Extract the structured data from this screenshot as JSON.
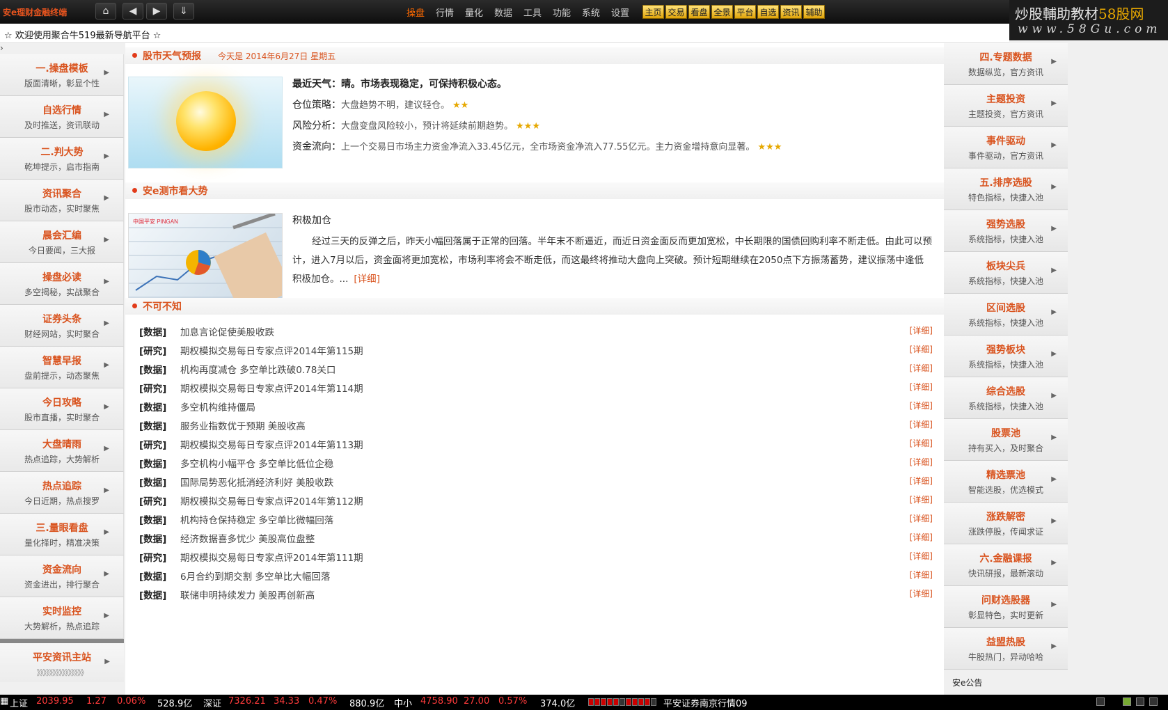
{
  "topbar": {
    "logo": "安e理财金融终端",
    "menu": [
      "操盘",
      "行情",
      "量化",
      "数据",
      "工具",
      "功能",
      "系统",
      "设置"
    ],
    "active_menu": "操盘",
    "quick": [
      "主页",
      "交易",
      "看盘",
      "全景",
      "平台",
      "自选",
      "资讯",
      "辅助"
    ],
    "brand_line1_a": "炒股輔助教材",
    "brand_line1_b": "58股网",
    "brand_line2": "www.58Gu.com"
  },
  "welcome": "☆ 欢迎使用聚合牛519最新导航平台 ☆",
  "left_nav": [
    {
      "title": "一.操盘模板",
      "sub": "版面清晰，彰显个性"
    },
    {
      "title": "自选行情",
      "sub": "及时推送，资讯联动"
    },
    {
      "title": "二.判大势",
      "sub": "乾坤提示，启市指南"
    },
    {
      "title": "资讯聚合",
      "sub": "股市动态，实时聚焦"
    },
    {
      "title": "晨会汇编",
      "sub": "今日要闻，三大报"
    },
    {
      "title": "操盘必读",
      "sub": "多空揭秘，实战聚合"
    },
    {
      "title": "证券头条",
      "sub": "财经网站，实时聚合"
    },
    {
      "title": "智慧早报",
      "sub": "盘前提示，动态聚焦"
    },
    {
      "title": "今日攻略",
      "sub": "股市直播，实时聚合"
    },
    {
      "title": "大盘晴雨",
      "sub": "热点追踪，大势解析"
    },
    {
      "title": "热点追踪",
      "sub": "今日近期，热点搜罗"
    },
    {
      "title": "三.量眼看盘",
      "sub": "量化择时，精准决策"
    },
    {
      "title": "资金流向",
      "sub": "资金进出，排行聚合"
    },
    {
      "title": "实时监控",
      "sub": "大势解析，热点追踪"
    }
  ],
  "left_bottom": {
    "title": "平安资讯主站",
    "sub": "》》》》》》》》》》》》》》》"
  },
  "weather": {
    "section_title": "股市天气预报",
    "date": "今天是 2014年6月27日 星期五",
    "headline": "最近天气：晴。市场表现稳定，可保持积极心态。",
    "rows": [
      {
        "key": "仓位策略：",
        "val": "大盘趋势不明，建议轻仓。",
        "stars": "★★"
      },
      {
        "key": "风险分析：",
        "val": "大盘变盘风险较小，预计将延续前期趋势。",
        "stars": "★★★"
      },
      {
        "key": "资金流向：",
        "val": "上一个交易日市场主力资金净流入33.45亿元，全市场资金净流入77.55亿元。主力资金增持意向显著。",
        "stars": "★★★"
      }
    ]
  },
  "analysis": {
    "section_title": "安e测市看大势",
    "title": "积极加仓",
    "body": "经过三天的反弹之后，昨天小幅回落属于正常的回落。半年末不断逼近，而近日资金面反而更加宽松，中长期限的国债回购利率不断走低。由此可以预计，进入7月以后，资金面将更加宽松，市场利率将会不断走低，而这最终将推动大盘向上突破。预计短期继续在2050点下方振荡蓄势，建议振荡中逢低积极加仓。...",
    "more": "[详细]",
    "img_text": "中国平安 PINGAN"
  },
  "news": {
    "section_title": "不可不知",
    "more_label": "[详细]",
    "items": [
      {
        "cat": "[数据]",
        "title": "加息言论促使美股收跌"
      },
      {
        "cat": "[研究]",
        "title": "期权模拟交易每日专家点评2014年第115期"
      },
      {
        "cat": "[数据]",
        "title": "机构再度减仓 多空单比跌破0.78关口"
      },
      {
        "cat": "[研究]",
        "title": "期权模拟交易每日专家点评2014年第114期"
      },
      {
        "cat": "[数据]",
        "title": "多空机构维持僵局"
      },
      {
        "cat": "[数据]",
        "title": "服务业指数优于预期 美股收高"
      },
      {
        "cat": "[研究]",
        "title": "期权模拟交易每日专家点评2014年第113期"
      },
      {
        "cat": "[数据]",
        "title": "多空机构小幅平仓 多空单比低位企稳"
      },
      {
        "cat": "[数据]",
        "title": "国际局势恶化抵消经济利好 美股收跌"
      },
      {
        "cat": "[研究]",
        "title": "期权模拟交易每日专家点评2014年第112期"
      },
      {
        "cat": "[数据]",
        "title": "机构持仓保持稳定 多空单比微幅回落"
      },
      {
        "cat": "[数据]",
        "title": "经济数据喜多忧少 美股高位盘整"
      },
      {
        "cat": "[研究]",
        "title": "期权模拟交易每日专家点评2014年第111期"
      },
      {
        "cat": "[数据]",
        "title": "6月合约到期交割 多空单比大幅回落"
      },
      {
        "cat": "[数据]",
        "title": "联储申明持续发力 美股再创新高"
      }
    ]
  },
  "right_nav": [
    {
      "title": "四.专题数据",
      "sub": "数据纵览，官方资讯"
    },
    {
      "title": "主题投资",
      "sub": "主题投资，官方资讯"
    },
    {
      "title": "事件驱动",
      "sub": "事件驱动，官方资讯"
    },
    {
      "title": "五.排序选股",
      "sub": "特色指标，快捷入池"
    },
    {
      "title": "强势选股",
      "sub": "系统指标，快捷入池"
    },
    {
      "title": "板块尖兵",
      "sub": "系统指标，快捷入池"
    },
    {
      "title": "区间选股",
      "sub": "系统指标，快捷入池"
    },
    {
      "title": "强势板块",
      "sub": "系统指标，快捷入池"
    },
    {
      "title": "综合选股",
      "sub": "系统指标，快捷入池"
    },
    {
      "title": "股票池",
      "sub": "持有买入，及时聚合"
    },
    {
      "title": "精选票池",
      "sub": "智能选股，优选模式"
    },
    {
      "title": "涨跌解密",
      "sub": "涨跌停股，传闻求证"
    },
    {
      "title": "六.金融课报",
      "sub": "快讯研报，最新滚动"
    },
    {
      "title": "问财选股器",
      "sub": "彰显特色，实时更新"
    },
    {
      "title": "益盟热股",
      "sub": "牛股热门，异动哈哈"
    }
  ],
  "announce": "安e公告",
  "status": {
    "sh_label": "上证",
    "sh_val": "2039.95",
    "sh_chg": "1.27",
    "sh_pct": "0.06%",
    "sh_amt": "528.9亿",
    "sz_label": "深证",
    "sz_val": "7326.21",
    "sz_chg": "34.33",
    "sz_pct": "0.47%",
    "sz_amt": "880.9亿",
    "zx_label": "中小",
    "zx_val": "4758.90",
    "zx_chg": "27.00",
    "zx_pct": "0.57%",
    "zx_amt": "374.0亿",
    "server": "平安证券南京行情09"
  }
}
